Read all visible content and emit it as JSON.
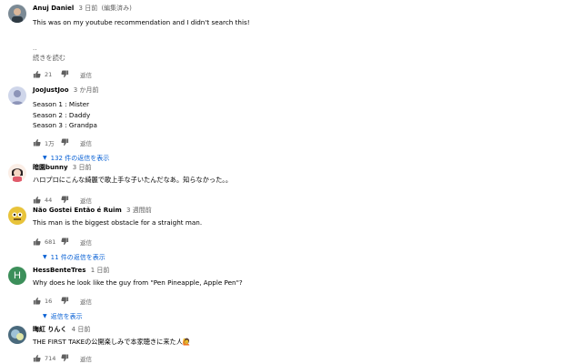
{
  "labels": {
    "reply": "返信",
    "read_more": "続きを読む",
    "edited": "(編集済み)"
  },
  "comments": [
    {
      "author": "Anuj Daniel",
      "time": "3 日前",
      "edited": "(編集済み)",
      "text": "This was on my youtube recommendation and I didn't search this!",
      "ellipsis": "..",
      "read_more": "続きを読む",
      "likes": "21",
      "avatar_color": "#7b8a95"
    },
    {
      "author": "JooJustJoo",
      "time": "3 か月前",
      "text": "Season 1 : Mister\nSeason 2 : Daddy\nSeason 3 : Grandpa",
      "likes": "1万",
      "replies": "132 件の返信を表示",
      "avatar_color": "#9aa4c8"
    },
    {
      "author": "暗園bunny",
      "time": "3 日前",
      "text": "ハロプロにこんな綺麗で歌上手な子いたんだなあ。知らなかった。。",
      "likes": "44",
      "avatar_color": "#f2d7c9"
    },
    {
      "author": "Não Gostei Então é Ruim",
      "time": "3 週間前",
      "text": "This man is the biggest obstacle for a straight man.",
      "likes": "681",
      "replies": "11 件の返信を表示",
      "avatar_color": "#e8c33a"
    },
    {
      "author": "HessBenteTres",
      "time": "1 日前",
      "text": "Why does he look like the guy from \"Pen Pineapple, Apple Pen\"?",
      "likes": "16",
      "replies": "返信を表示",
      "avatar_letter": "H",
      "avatar_color": "#3c8f5a"
    },
    {
      "author": "晦紅 りんく",
      "time": "4 日前",
      "text": "THE FIRST TAKEの公開楽しみで本家聴きに来た人🙋",
      "likes": "714",
      "avatar_color": "#4a6a7d"
    }
  ]
}
